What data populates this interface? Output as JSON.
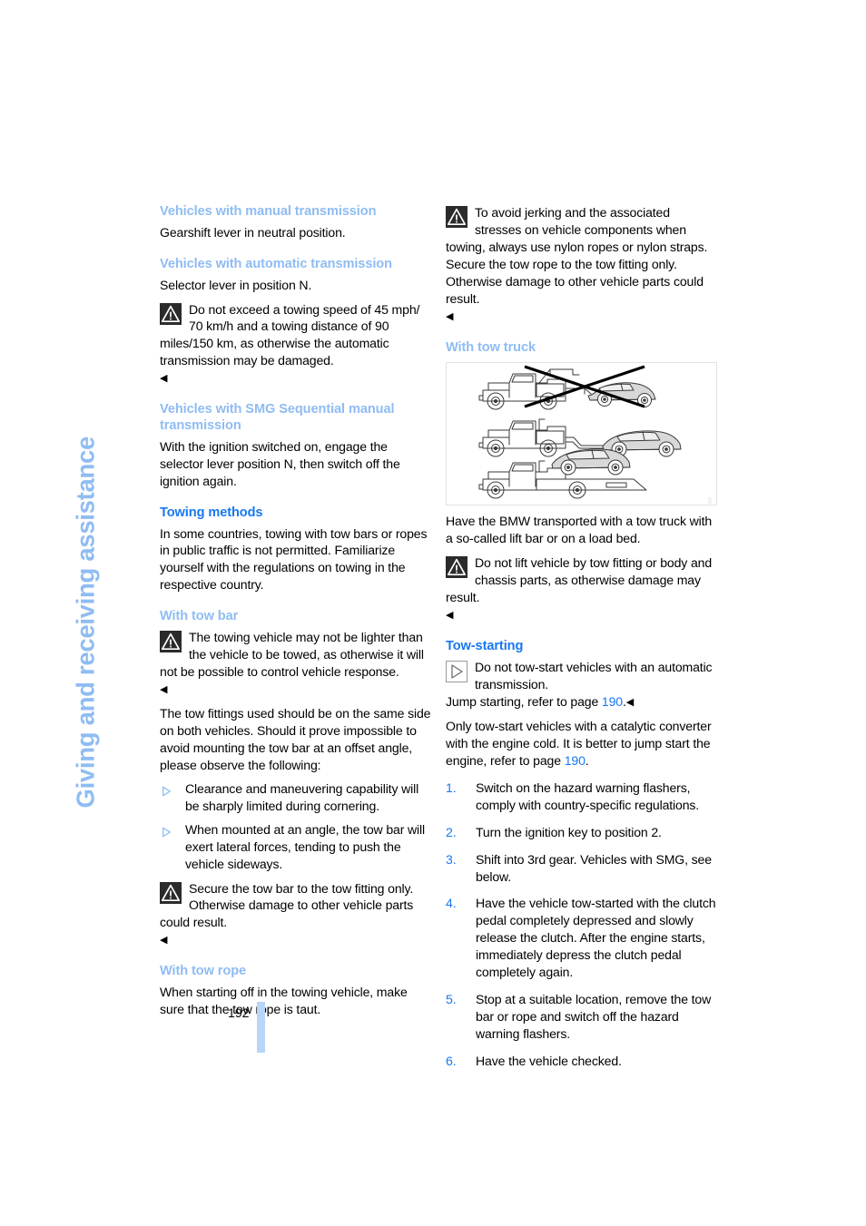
{
  "page": {
    "chapter_title": "Giving and receiving assistance",
    "folio": "192",
    "accent_light_blue": "#8fbcf3",
    "accent_blue": "#1878f0",
    "bar_blue": "#b9d5f7"
  },
  "left_column": {
    "s1": {
      "heading": "Vehicles with manual transmission",
      "body": "Gearshift lever in neutral position."
    },
    "s2": {
      "heading": "Vehicles with automatic transmission",
      "body": "Selector lever in position N.",
      "warning": {
        "icon": "warning-triangle-icon",
        "text": "Do not exceed a towing speed of 45 mph/ 70 km/h and a towing distance of 90 miles/150 km, as otherwise the automatic transmission may be damaged.",
        "endmark": "◀"
      }
    },
    "s3": {
      "heading": "Vehicles with SMG Sequential manual transmission",
      "body": "With the ignition switched on, engage the selector lever position N, then switch off the ignition again."
    },
    "s4": {
      "heading": "Towing methods",
      "body": "In some countries, towing with tow bars or ropes in public traffic is not permitted. Familiarize yourself with the regulations on towing in the respective country."
    },
    "s5": {
      "heading": "With tow bar",
      "warning": {
        "icon": "warning-triangle-icon",
        "text": "The towing vehicle may not be lighter than the vehicle to be towed, as otherwise it will not be possible to control vehicle response.",
        "endmark": "◀"
      },
      "body": "The tow fittings used should be on the same side on both vehicles. Should it prove impossible to avoid mounting the tow bar at an offset angle, please observe the following:",
      "bullets": [
        "Clearance and maneuvering capability will be sharply limited during cornering.",
        "When mounted at an angle, the tow bar will exert lateral forces, tending to push the vehicle sideways."
      ],
      "warning2": {
        "icon": "warning-triangle-icon",
        "text": "Secure the tow bar to the tow fitting only. Otherwise damage to other vehicle parts could result.",
        "endmark": "◀"
      }
    },
    "s6": {
      "heading": "With tow rope",
      "body": "When starting off in the towing vehicle, make sure that the tow rope is taut."
    }
  },
  "right_column": {
    "r1": {
      "warning": {
        "icon": "warning-triangle-icon",
        "text": "To avoid jerking and the associated stresses on vehicle components when towing, always use nylon ropes or nylon straps. Secure the tow rope to the tow fitting only. Otherwise damage to other vehicle parts could result.",
        "endmark": "◀"
      }
    },
    "r2": {
      "heading": "With tow truck",
      "figure": {
        "name": "tow-truck-methods-illustration",
        "caption_id": "BMW 5 OBSTM 0.00",
        "rows": [
          "hook-lift towing crossed out",
          "lift-bar towing",
          "flat load-bed towing"
        ]
      },
      "body": "Have the BMW transported with a tow truck with a so-called lift bar or on a load bed.",
      "warning": {
        "icon": "warning-triangle-icon",
        "text": "Do not lift vehicle by tow fitting or body and chassis parts, as otherwise damage may result.",
        "endmark": "◀"
      }
    },
    "r3": {
      "heading": "Tow-starting",
      "note": {
        "icon": "note-triangle-icon",
        "text": "Do not tow-start vehicles with an automatic transmission."
      },
      "jump_line_pre": "Jump starting, refer to page ",
      "jump_line_link": "190",
      "jump_line_post": ".",
      "jump_endmark": "◀",
      "para_pre": "Only tow-start vehicles with a catalytic converter with the engine cold. It is better to jump start the engine, refer to page ",
      "para_link": "190",
      "para_post": ".",
      "steps": [
        {
          "num": "1.",
          "text": "Switch on the hazard warning flashers, comply with country-specific regulations."
        },
        {
          "num": "2.",
          "text": "Turn the ignition key to position 2."
        },
        {
          "num": "3.",
          "text": "Shift into 3rd gear. Vehicles with SMG, see below."
        },
        {
          "num": "4.",
          "text": "Have the vehicle tow-started with the clutch pedal completely depressed and slowly release the clutch. After the engine starts, immediately depress the clutch pedal completely again."
        },
        {
          "num": "5.",
          "text": "Stop at a suitable location, remove the tow bar or rope and switch off the hazard warning flashers."
        },
        {
          "num": "6.",
          "text": "Have the vehicle checked."
        }
      ]
    }
  }
}
